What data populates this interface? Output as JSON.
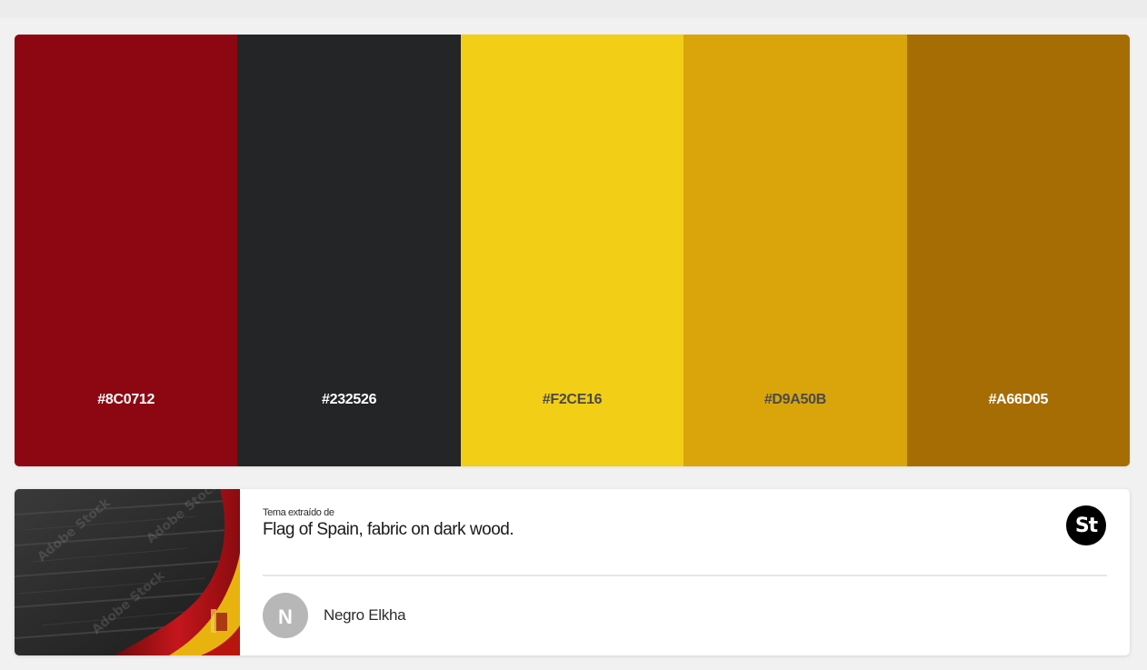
{
  "palette": {
    "swatches": [
      {
        "hex": "#8C0712",
        "label": "#8C0712",
        "label_color": "#ffffff"
      },
      {
        "hex": "#232526",
        "label": "#232526",
        "label_color": "#ffffff"
      },
      {
        "hex": "#F2CE16",
        "label": "#F2CE16",
        "label_color": "#4a4a4a"
      },
      {
        "hex": "#D9A50B",
        "label": "#D9A50B",
        "label_color": "#4a4a4a"
      },
      {
        "hex": "#A66D05",
        "label": "#A66D05",
        "label_color": "#ffffff"
      }
    ]
  },
  "source": {
    "caption": "Tema extraído de",
    "title": "Flag of Spain, fabric on dark wood.",
    "badge_label": "St",
    "thumbnail_icon": "spain-flag-on-dark-wood-image"
  },
  "author": {
    "initial": "N",
    "name": "Negro Elkha"
  },
  "colors": {
    "page_background": "#f1f1f1",
    "card_background": "#ffffff",
    "avatar_background": "#b7b7b7",
    "badge_background": "#000000"
  }
}
